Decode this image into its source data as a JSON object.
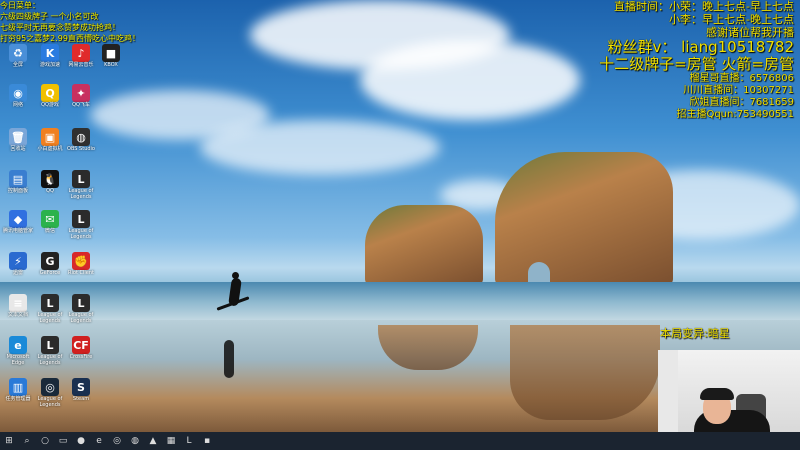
{
  "overlay_top_left": [
    "今日菜单：",
    "六级四级牌子 一个小名可改",
    "七级平时无再要念赞梦成功抢鸡！",
    "打穷95之嘉梦2.99直西懵吃心中吃鸡！"
  ],
  "overlay_top_right": [
    {
      "text": "直播时间：小荣：晚上七点-早上七点",
      "size": 11,
      "color": "#f0e000"
    },
    {
      "text": "小李：早上七点-晚上七点",
      "size": 11,
      "color": "#f0e000"
    },
    {
      "text": "感谢诸位帮我开播",
      "size": 11,
      "color": "#f0e000"
    },
    {
      "text": "粉丝群v： liang10518782",
      "size": 15,
      "color": "#f0e000"
    },
    {
      "text": "十二级牌子=房管 火箭=房管",
      "size": 15,
      "color": "#f0e000"
    },
    {
      "text": "榴星哥直播：6576806",
      "size": 10,
      "color": "#f0e000"
    },
    {
      "text": "川川直播间：10307271",
      "size": 10,
      "color": "#f0e000"
    },
    {
      "text": "欣姐直播间：7681659",
      "size": 10,
      "color": "#f0e000"
    },
    {
      "text": "招主播Qqun:753490551",
      "size": 10,
      "color": "#f0e000"
    }
  ],
  "overlay_mid_right": "本局变异:暗星",
  "desktop_icons": [
    {
      "label": "全屏",
      "icon": "recycle-bin-icon",
      "color": "#4a8fd8",
      "glyph": "♻",
      "col": 0,
      "row": 0
    },
    {
      "label": "游戏加速",
      "icon": "accelerator-icon",
      "color": "#2a7be0",
      "glyph": "K",
      "col": 1,
      "row": 0
    },
    {
      "label": "网易云音乐",
      "icon": "music-icon",
      "color": "#e02b2b",
      "glyph": "♪",
      "col": 2,
      "row": 0
    },
    {
      "label": "KBOX",
      "icon": "kbox-icon",
      "color": "#222",
      "glyph": "■",
      "col": 3,
      "row": 0
    },
    {
      "label": "网络",
      "icon": "network-icon",
      "color": "#3a8ad8",
      "glyph": "◉",
      "col": 0,
      "row": 1
    },
    {
      "label": "QQ游戏",
      "icon": "qq-game-icon",
      "color": "#f0c000",
      "glyph": "Q",
      "col": 1,
      "row": 1
    },
    {
      "label": "QQ飞车",
      "icon": "qq-speed-icon",
      "color": "#c83060",
      "glyph": "✦",
      "col": 2,
      "row": 1
    },
    {
      "label": "回收站",
      "icon": "trash-icon",
      "color": "#7aa6d8",
      "glyph": "🗑",
      "col": 0,
      "row": 2
    },
    {
      "label": "小白虚拟机",
      "icon": "vm-icon",
      "color": "#f08020",
      "glyph": "▣",
      "col": 1,
      "row": 2
    },
    {
      "label": "OBS Studio",
      "icon": "obs-icon",
      "color": "#303030",
      "glyph": "◍",
      "col": 2,
      "row": 2
    },
    {
      "label": "控制面板",
      "icon": "control-panel-icon",
      "color": "#3a7ed0",
      "glyph": "▤",
      "col": 0,
      "row": 3
    },
    {
      "label": "QQ",
      "icon": "qq-icon",
      "color": "#111",
      "glyph": "🐧",
      "col": 1,
      "row": 3
    },
    {
      "label": "League of Legends",
      "icon": "lol-icon",
      "color": "#2b2b2b",
      "glyph": "L",
      "col": 2,
      "row": 3
    },
    {
      "label": "腾讯电脑管家",
      "icon": "pc-manager-icon",
      "color": "#3070e0",
      "glyph": "◆",
      "col": 0,
      "row": 4
    },
    {
      "label": "微信",
      "icon": "wechat-icon",
      "color": "#2bb24c",
      "glyph": "✉",
      "col": 1,
      "row": 4
    },
    {
      "label": "League of Legends",
      "icon": "lol-icon",
      "color": "#2b2b2b",
      "glyph": "L",
      "col": 2,
      "row": 4
    },
    {
      "label": "迅雷",
      "icon": "thunder-icon",
      "color": "#2a6ad0",
      "glyph": "⚡",
      "col": 0,
      "row": 5
    },
    {
      "label": "GeForce",
      "icon": "geforce-icon",
      "color": "#222",
      "glyph": "G",
      "col": 1,
      "row": 5
    },
    {
      "label": "Riot Client",
      "icon": "riot-icon",
      "color": "#d8282a",
      "glyph": "✊",
      "col": 2,
      "row": 5
    },
    {
      "label": "文本文档",
      "icon": "text-file-icon",
      "color": "#e8e8e8",
      "glyph": "≡",
      "col": 0,
      "row": 6
    },
    {
      "label": "League of Legends",
      "icon": "lol-icon",
      "color": "#2b2b2b",
      "glyph": "L",
      "col": 1,
      "row": 6
    },
    {
      "label": "League of Legends",
      "icon": "lol-icon",
      "color": "#2b2b2b",
      "glyph": "L",
      "col": 2,
      "row": 6
    },
    {
      "label": "Microsoft Edge",
      "icon": "edge-icon",
      "color": "#1a8ad8",
      "glyph": "e",
      "col": 0,
      "row": 7
    },
    {
      "label": "League of Legends",
      "icon": "lol-icon",
      "color": "#2b2b2b",
      "glyph": "L",
      "col": 1,
      "row": 7
    },
    {
      "label": "CrossFire",
      "icon": "crossfire-icon",
      "color": "#d02020",
      "glyph": "CF",
      "col": 2,
      "row": 7
    },
    {
      "label": "任务管理器",
      "icon": "task-manager-icon",
      "color": "#2a7ad8",
      "glyph": "▥",
      "col": 0,
      "row": 8
    },
    {
      "label": "League of Legends",
      "icon": "lol-client-icon",
      "color": "#1a2a3a",
      "glyph": "◎",
      "col": 1,
      "row": 8
    },
    {
      "label": "Steam",
      "icon": "steam-icon",
      "color": "#1a3050",
      "glyph": "S",
      "col": 2,
      "row": 8
    }
  ],
  "taskbar": [
    {
      "icon": "windows-start-icon",
      "glyph": "⊞"
    },
    {
      "icon": "search-icon",
      "glyph": "⌕"
    },
    {
      "icon": "task-view-icon",
      "glyph": "○"
    },
    {
      "icon": "folder-icon",
      "glyph": "▭"
    },
    {
      "icon": "qq-game-icon",
      "glyph": "●"
    },
    {
      "icon": "edge-icon",
      "glyph": "e"
    },
    {
      "icon": "browser-icon",
      "glyph": "◎"
    },
    {
      "icon": "obs-icon",
      "glyph": "◍"
    },
    {
      "icon": "app-icon",
      "glyph": "▲"
    },
    {
      "icon": "minecraft-icon",
      "glyph": "▦"
    },
    {
      "icon": "lol-icon",
      "glyph": "L"
    },
    {
      "icon": "app-icon",
      "glyph": "▪"
    }
  ]
}
